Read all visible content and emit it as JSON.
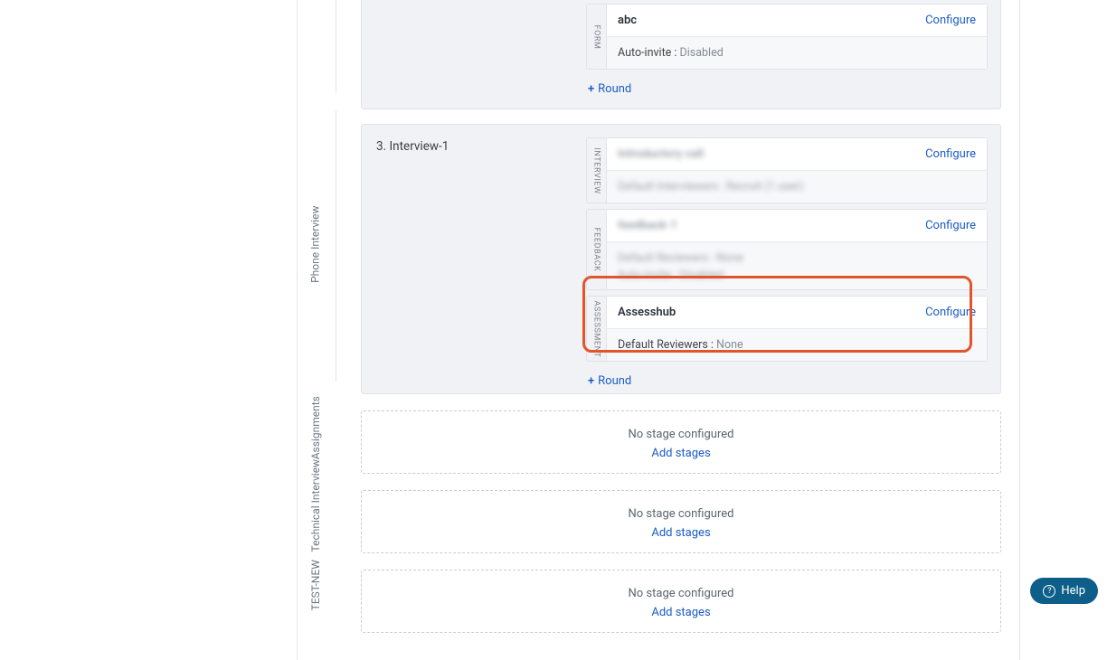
{
  "header_stage": {
    "form": {
      "tag": "FORM",
      "title": "abc",
      "configure": "Configure",
      "meta_label": "Auto-invite :",
      "meta_value": " Disabled"
    },
    "add_round": "Round"
  },
  "stage2": {
    "side_label": "Phone Interview",
    "title": "3. Interview-1",
    "interview": {
      "tag": "INTERVIEW",
      "title": "Introductory call",
      "configure": "Configure",
      "meta": "Default Interviewers : Recruit (1 user)"
    },
    "feedback": {
      "tag": "FEEDBACK",
      "title": "feedback-1",
      "configure": "Configure",
      "meta1": "Default Reviewers : None",
      "meta2": "Auto-invite : Disabled"
    },
    "assessment": {
      "tag": "ASSESSMENT",
      "title": "Assesshub",
      "configure": "Configure",
      "meta_label": "Default Reviewers :",
      "meta_value": " None"
    },
    "add_round": "Round"
  },
  "empty_stages": [
    {
      "side_label": "Assignments",
      "msg": "No stage configured",
      "action": "Add stages"
    },
    {
      "side_label": "Technical Interview",
      "msg": "No stage configured",
      "action": "Add stages"
    },
    {
      "side_label": "TEST-NEW",
      "msg": "No stage configured",
      "action": "Add stages"
    }
  ],
  "help": "Help"
}
